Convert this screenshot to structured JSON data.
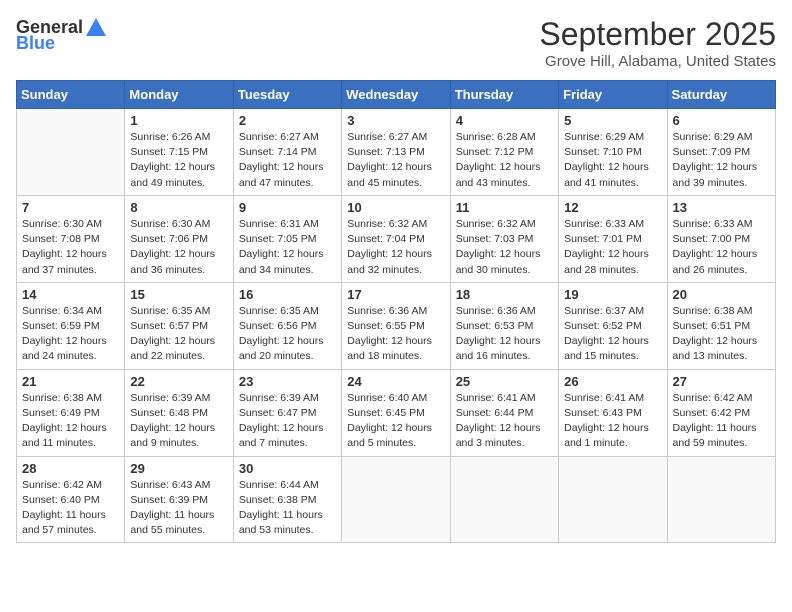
{
  "header": {
    "logo_general": "General",
    "logo_blue": "Blue",
    "month_title": "September 2025",
    "location": "Grove Hill, Alabama, United States"
  },
  "calendar": {
    "days_of_week": [
      "Sunday",
      "Monday",
      "Tuesday",
      "Wednesday",
      "Thursday",
      "Friday",
      "Saturday"
    ],
    "weeks": [
      [
        {
          "day": "",
          "info": ""
        },
        {
          "day": "1",
          "info": "Sunrise: 6:26 AM\nSunset: 7:15 PM\nDaylight: 12 hours\nand 49 minutes."
        },
        {
          "day": "2",
          "info": "Sunrise: 6:27 AM\nSunset: 7:14 PM\nDaylight: 12 hours\nand 47 minutes."
        },
        {
          "day": "3",
          "info": "Sunrise: 6:27 AM\nSunset: 7:13 PM\nDaylight: 12 hours\nand 45 minutes."
        },
        {
          "day": "4",
          "info": "Sunrise: 6:28 AM\nSunset: 7:12 PM\nDaylight: 12 hours\nand 43 minutes."
        },
        {
          "day": "5",
          "info": "Sunrise: 6:29 AM\nSunset: 7:10 PM\nDaylight: 12 hours\nand 41 minutes."
        },
        {
          "day": "6",
          "info": "Sunrise: 6:29 AM\nSunset: 7:09 PM\nDaylight: 12 hours\nand 39 minutes."
        }
      ],
      [
        {
          "day": "7",
          "info": "Sunrise: 6:30 AM\nSunset: 7:08 PM\nDaylight: 12 hours\nand 37 minutes."
        },
        {
          "day": "8",
          "info": "Sunrise: 6:30 AM\nSunset: 7:06 PM\nDaylight: 12 hours\nand 36 minutes."
        },
        {
          "day": "9",
          "info": "Sunrise: 6:31 AM\nSunset: 7:05 PM\nDaylight: 12 hours\nand 34 minutes."
        },
        {
          "day": "10",
          "info": "Sunrise: 6:32 AM\nSunset: 7:04 PM\nDaylight: 12 hours\nand 32 minutes."
        },
        {
          "day": "11",
          "info": "Sunrise: 6:32 AM\nSunset: 7:03 PM\nDaylight: 12 hours\nand 30 minutes."
        },
        {
          "day": "12",
          "info": "Sunrise: 6:33 AM\nSunset: 7:01 PM\nDaylight: 12 hours\nand 28 minutes."
        },
        {
          "day": "13",
          "info": "Sunrise: 6:33 AM\nSunset: 7:00 PM\nDaylight: 12 hours\nand 26 minutes."
        }
      ],
      [
        {
          "day": "14",
          "info": "Sunrise: 6:34 AM\nSunset: 6:59 PM\nDaylight: 12 hours\nand 24 minutes."
        },
        {
          "day": "15",
          "info": "Sunrise: 6:35 AM\nSunset: 6:57 PM\nDaylight: 12 hours\nand 22 minutes."
        },
        {
          "day": "16",
          "info": "Sunrise: 6:35 AM\nSunset: 6:56 PM\nDaylight: 12 hours\nand 20 minutes."
        },
        {
          "day": "17",
          "info": "Sunrise: 6:36 AM\nSunset: 6:55 PM\nDaylight: 12 hours\nand 18 minutes."
        },
        {
          "day": "18",
          "info": "Sunrise: 6:36 AM\nSunset: 6:53 PM\nDaylight: 12 hours\nand 16 minutes."
        },
        {
          "day": "19",
          "info": "Sunrise: 6:37 AM\nSunset: 6:52 PM\nDaylight: 12 hours\nand 15 minutes."
        },
        {
          "day": "20",
          "info": "Sunrise: 6:38 AM\nSunset: 6:51 PM\nDaylight: 12 hours\nand 13 minutes."
        }
      ],
      [
        {
          "day": "21",
          "info": "Sunrise: 6:38 AM\nSunset: 6:49 PM\nDaylight: 12 hours\nand 11 minutes."
        },
        {
          "day": "22",
          "info": "Sunrise: 6:39 AM\nSunset: 6:48 PM\nDaylight: 12 hours\nand 9 minutes."
        },
        {
          "day": "23",
          "info": "Sunrise: 6:39 AM\nSunset: 6:47 PM\nDaylight: 12 hours\nand 7 minutes."
        },
        {
          "day": "24",
          "info": "Sunrise: 6:40 AM\nSunset: 6:45 PM\nDaylight: 12 hours\nand 5 minutes."
        },
        {
          "day": "25",
          "info": "Sunrise: 6:41 AM\nSunset: 6:44 PM\nDaylight: 12 hours\nand 3 minutes."
        },
        {
          "day": "26",
          "info": "Sunrise: 6:41 AM\nSunset: 6:43 PM\nDaylight: 12 hours\nand 1 minute."
        },
        {
          "day": "27",
          "info": "Sunrise: 6:42 AM\nSunset: 6:42 PM\nDaylight: 11 hours\nand 59 minutes."
        }
      ],
      [
        {
          "day": "28",
          "info": "Sunrise: 6:42 AM\nSunset: 6:40 PM\nDaylight: 11 hours\nand 57 minutes."
        },
        {
          "day": "29",
          "info": "Sunrise: 6:43 AM\nSunset: 6:39 PM\nDaylight: 11 hours\nand 55 minutes."
        },
        {
          "day": "30",
          "info": "Sunrise: 6:44 AM\nSunset: 6:38 PM\nDaylight: 11 hours\nand 53 minutes."
        },
        {
          "day": "",
          "info": ""
        },
        {
          "day": "",
          "info": ""
        },
        {
          "day": "",
          "info": ""
        },
        {
          "day": "",
          "info": ""
        }
      ]
    ]
  }
}
